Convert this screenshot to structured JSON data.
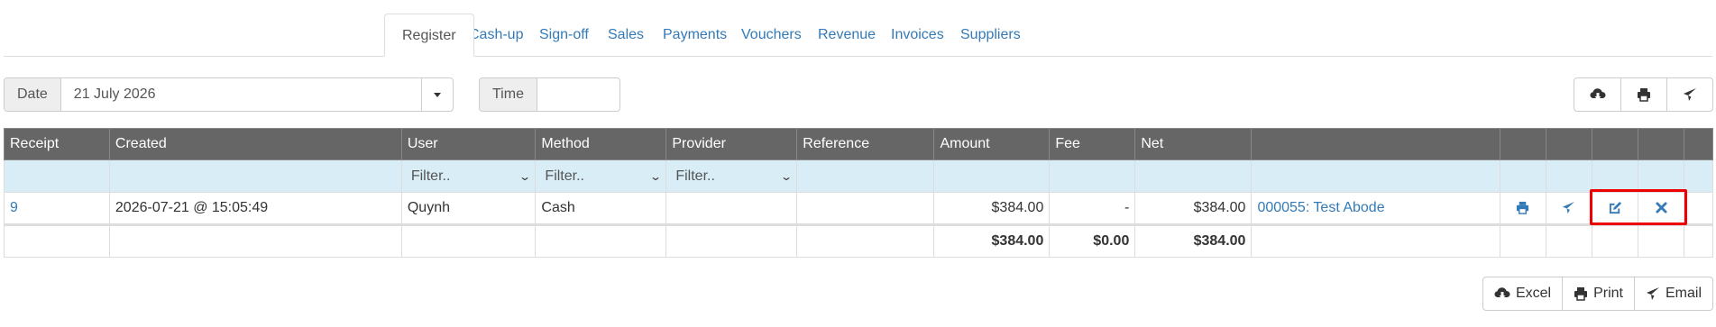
{
  "tabs": [
    {
      "label": "Register"
    },
    {
      "label": "Cash-up"
    },
    {
      "label": "Sign-off"
    },
    {
      "label": "Sales"
    },
    {
      "label": "Payments"
    },
    {
      "label": "Vouchers"
    },
    {
      "label": "Revenue"
    },
    {
      "label": "Invoices"
    },
    {
      "label": "Suppliers"
    }
  ],
  "filters": {
    "date_label": "Date",
    "date_value": "21 July 2026",
    "time_label": "Time",
    "time_value": ""
  },
  "table": {
    "headers": [
      "Receipt",
      "Created",
      "User",
      "Method",
      "Provider",
      "Reference",
      "Amount",
      "Fee",
      "Net"
    ],
    "filter_placeholder": "Filter..",
    "rows": [
      {
        "receipt": "9",
        "created": "2026-07-21 @ 15:05:49",
        "user": "Quynh",
        "method": "Cash",
        "provider": "",
        "reference": "",
        "amount": "$384.00",
        "fee": "-",
        "net": "$384.00",
        "link": "000055: Test Abode"
      }
    ],
    "totals": {
      "amount": "$384.00",
      "fee": "$0.00",
      "net": "$384.00"
    }
  },
  "actions": {
    "excel": "Excel",
    "print": "Print",
    "email": "Email"
  },
  "colors": {
    "accent": "#337ab7",
    "header_bg": "#666666",
    "filter_row": "#d9edf7",
    "highlight": "#ee0000"
  }
}
